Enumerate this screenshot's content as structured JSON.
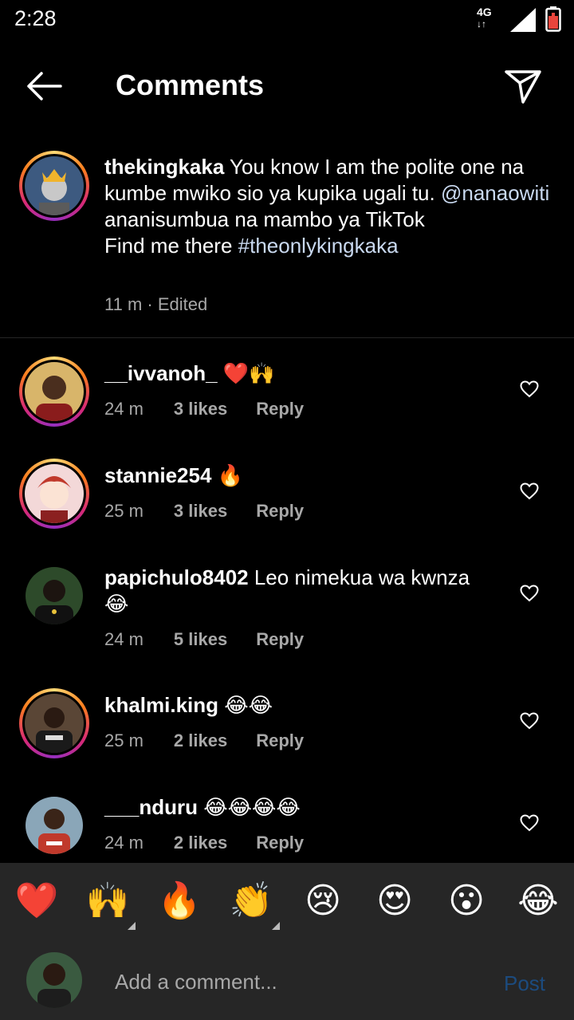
{
  "status": {
    "time": "2:28",
    "network": "4G"
  },
  "header": {
    "title": "Comments"
  },
  "caption": {
    "username": "thekingkaka",
    "text_1": " You know I am the polite one na kumbe mwiko sio ya kupika ugali tu. ",
    "mention": "@nanaowiti",
    "text_2": " ananisumbua na mambo ya TikTok",
    "text_3": "Find me there ",
    "hashtag": "#theonlykingkaka",
    "time": "11 m",
    "edited": " · Edited"
  },
  "comments": [
    {
      "username": "__ivvanoh_",
      "text": " ❤️🙌",
      "time": "24 m",
      "likes": "3 likes",
      "reply": "Reply"
    },
    {
      "username": "stannie254",
      "text": " 🔥",
      "time": "25 m",
      "likes": "3 likes",
      "reply": "Reply"
    },
    {
      "username": "papichulo8402",
      "text": " Leo nimekua wa kwnza 😂",
      "time": "24 m",
      "likes": "5 likes",
      "reply": "Reply"
    },
    {
      "username": "khalmi.king",
      "text": " 😂😂",
      "time": "25 m",
      "likes": "2 likes",
      "reply": "Reply"
    },
    {
      "username": "___nduru",
      "text": " 😂😂😂😂",
      "time": "24 m",
      "likes": "2 likes",
      "reply": "Reply"
    }
  ],
  "emoji_bar": [
    "❤️",
    "🙌",
    "🔥",
    "👏",
    "😢",
    "😍",
    "😮",
    "😂"
  ],
  "compose": {
    "placeholder": "Add a comment...",
    "post_label": "Post"
  },
  "colors": {
    "background": "#000000",
    "panel": "#262626",
    "muted_text": "#a8a8a8",
    "post_disabled": "#1c4b7e",
    "link": "#c9d9f0"
  }
}
